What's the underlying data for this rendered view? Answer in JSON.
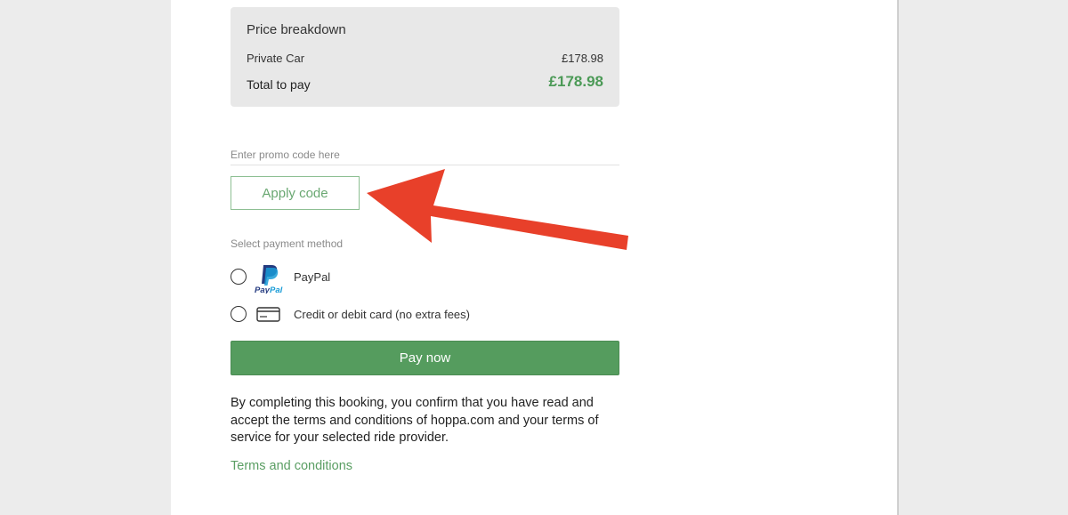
{
  "price_breakdown": {
    "title": "Price breakdown",
    "line_label": "Private Car",
    "line_value": "£178.98",
    "total_label": "Total to pay",
    "total_value": "£178.98"
  },
  "promo": {
    "placeholder": "Enter promo code here",
    "apply_label": "Apply code"
  },
  "payment": {
    "section_label": "Select payment method",
    "options": [
      {
        "label": "PayPal",
        "icon": "paypal-logo-icon",
        "selected": false
      },
      {
        "label": "Credit or debit card (no extra fees)",
        "icon": "credit-card-icon",
        "selected": false
      }
    ],
    "pay_label": "Pay now"
  },
  "terms": {
    "text": "By completing this booking, you confirm that you have read and accept the terms and conditions of hoppa.com and your terms of service for your selected ride provider.",
    "link_label": "Terms and conditions"
  },
  "annotation": {
    "icon": "red-arrow-icon",
    "color": "#e8402a"
  },
  "colors": {
    "accent_green": "#559c5e",
    "price_green": "#4c9a57",
    "panel_grey": "#e8e8e8"
  }
}
